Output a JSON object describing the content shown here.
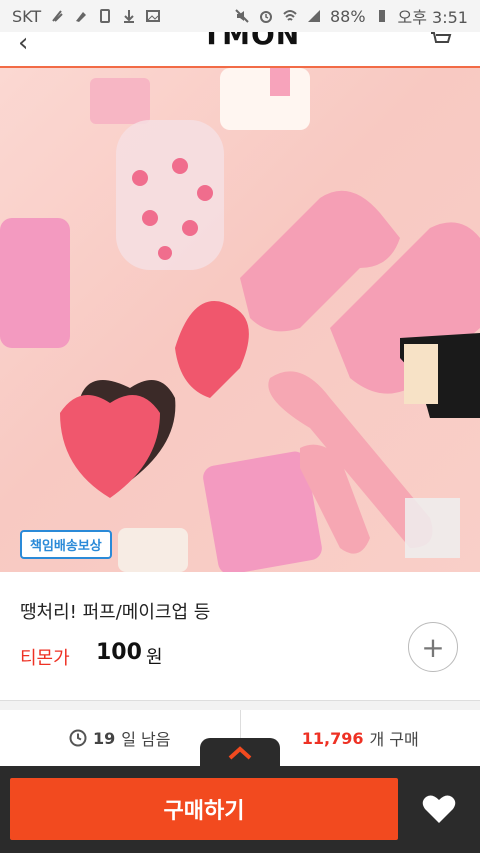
{
  "status_bar": {
    "carrier": "SKT",
    "battery": "88%",
    "time": "오후 3:51"
  },
  "header": {
    "logo": "TMON"
  },
  "product": {
    "badge": "책임배송보상",
    "title": "땡처리! 퍼프/메이크업 등",
    "price_label": "티몬가",
    "price": "100",
    "price_unit": "원"
  },
  "stats": {
    "days_left_num": "19",
    "days_left_text": "일 남음",
    "sold_count": "11,796",
    "sold_text": "개 구매"
  },
  "bottom": {
    "buy_label": "구매하기"
  },
  "colors": {
    "accent": "#f24a1f",
    "price_red": "#ee3124",
    "badge_blue": "#2a8ad8"
  }
}
